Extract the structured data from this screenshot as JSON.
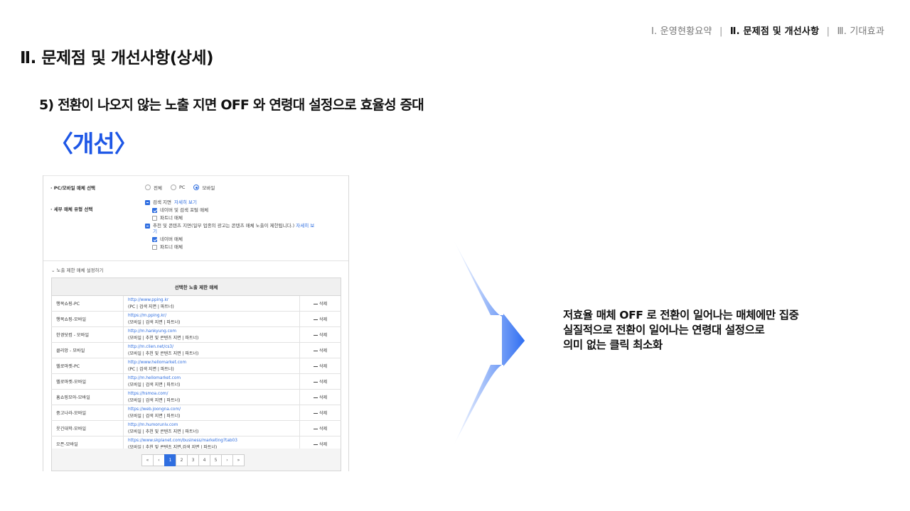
{
  "nav": {
    "item1": "Ⅰ. 운영현황요약",
    "item2": "Ⅱ. 문제점 및 개선사항",
    "item3": "Ⅲ. 기대효과",
    "sep": "Ⅰ"
  },
  "title": "Ⅱ. 문제점 및 개선사항(상세)",
  "subtitle": "5) 전환이 나오지 않는 노출 지면 OFF 와 연령대 설정으로 효율성 증대",
  "tag": "〈개선〉",
  "panel": {
    "media_label": "· PC/모바일 매체 선택",
    "radios": [
      "전체",
      "PC",
      "모바일"
    ],
    "detail_label": "· 세부 매체 유형 선택",
    "search_area": "검색 지면",
    "search_link": "자세히 보기",
    "naver_search": "네이버 및 검색 포털 매체",
    "partner1": "파트너 매체",
    "content_area": "추천 및 콘텐츠 지면(일부 업종의 광고는 콘텐츠 매체 노출이 제한됩니다.)",
    "content_link": "자세히 보",
    "content_link_tail": "기",
    "naver_media": "네이버 매체",
    "partner2": "파트너 매체",
    "expand": "노출 제한 매체 설정하기",
    "table_header": "선택한 노출 제한 매체",
    "delete": "삭제",
    "rows": [
      {
        "name": "행복쇼핑-PC",
        "url": "http://www.pping.kr",
        "desc": "(PC | 검색 지면 | 파트너)"
      },
      {
        "name": "행복쇼핑-모바일",
        "url": "https://m.pping.kr/",
        "desc": "(모바일 | 검색 지면 | 파트너)"
      },
      {
        "name": "한경닷컴 - 모바일",
        "url": "http://m.hankyung.com",
        "desc": "(모바일 | 추천 및 콘텐츠 지면 | 파트너)"
      },
      {
        "name": "클리앙 - 모바일",
        "url": "http://m.clien.net/cs3/",
        "desc": "(모바일 | 추천 및 콘텐츠 지면 | 파트너)"
      },
      {
        "name": "헬로마켓-PC",
        "url": "http://www.hellomarket.com",
        "desc": "(PC | 검색 지면 | 파트너)"
      },
      {
        "name": "헬로마켓-모바일",
        "url": "http://m.hellomarket.com",
        "desc": "(모바일 | 검색 지면 | 파트너)"
      },
      {
        "name": "홈쇼핑모아-모바일",
        "url": "https://hsmoa.com/",
        "desc": "(모바일 | 검색 지면 | 파트너)"
      },
      {
        "name": "중고나라-모바일",
        "url": "https://web.joongna.com/",
        "desc": "(모바일 | 검색 지면 | 파트너)"
      },
      {
        "name": "웃긴대학-모바일",
        "url": "http://m.humoruniv.com",
        "desc": "(모바일 | 추천 및 콘텐츠 지면 | 파트너)"
      },
      {
        "name": "오픈-모바일",
        "url": "https://www.skplanet.com/business/marketing?tab03",
        "desc": "(모바일 | 추천 및 콘텐츠 지면,검색 지면 | 파트너)"
      }
    ],
    "pager": [
      "«",
      "‹",
      "1",
      "2",
      "3",
      "4",
      "5",
      "›",
      "»"
    ],
    "pager_active": "1"
  },
  "description": [
    "저효율 매체 OFF 로 전환이 일어나는 매체에만 집중",
    "실질적으로 전환이 일어나는 연령대 설정으로",
    "의미 없는 클릭 최소화"
  ],
  "colors": {
    "accent": "#1e57e6",
    "link": "#2f6ee0",
    "arrow_start": "#ffffff",
    "arrow_end": "#2f6ef2"
  }
}
